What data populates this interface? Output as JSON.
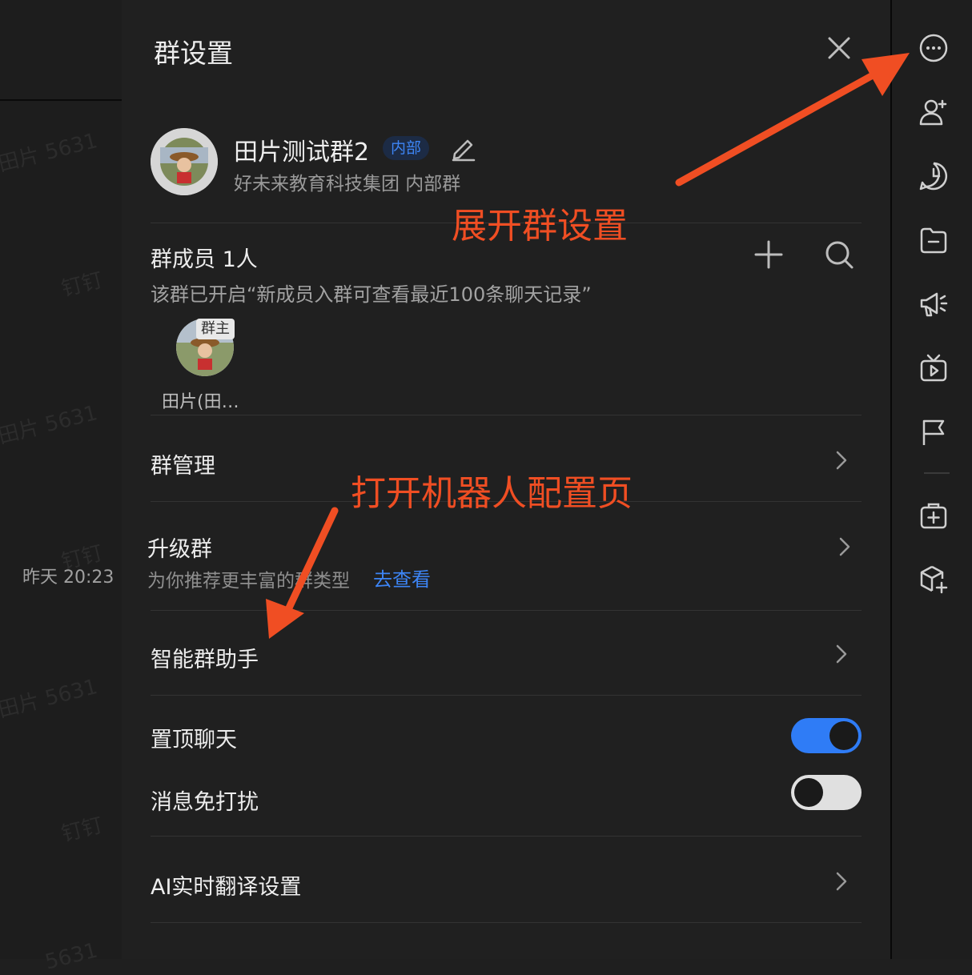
{
  "chat": {
    "watermarks": [
      "田片 5631",
      "钉钉",
      "田片 5631",
      "钉钉",
      "田片 5631",
      "钉钉",
      "5631"
    ],
    "time": "昨天 20:23"
  },
  "panel": {
    "title": "群设置",
    "group": {
      "name": "田片测试群2",
      "tag": "内部",
      "subtitle": "好未来教育科技集团  内部群"
    },
    "members": {
      "title": "群成员 1人",
      "note": "该群已开启“新成员入群可查看最近100条聊天记录”",
      "list": [
        {
          "name": "田片(田…",
          "badge": "群主"
        }
      ]
    },
    "rows": {
      "group_manage": "群管理",
      "upgrade": {
        "label": "升级群",
        "sub": "为你推荐更丰富的群类型",
        "link": "去查看"
      },
      "assistant": "智能群助手",
      "pin_chat": {
        "label": "置顶聊天",
        "on": true
      },
      "mute": {
        "label": "消息免打扰",
        "on": false
      },
      "ai_translate": "AI实时翻译设置"
    }
  },
  "toolbar": {
    "icons": [
      "more-icon",
      "add-member-icon",
      "history-icon",
      "folder-icon",
      "announcement-icon",
      "live-icon",
      "flag-icon",
      "add-app-icon",
      "cube-add-icon"
    ]
  },
  "annotations": {
    "expand": "展开群设置",
    "open_robot": "打开机器人配置页"
  },
  "colors": {
    "accent": "#3d85f5",
    "annotation": "#f04e23",
    "toggle_on": "#2f7cf6",
    "toggle_off": "#e0e0e0"
  }
}
